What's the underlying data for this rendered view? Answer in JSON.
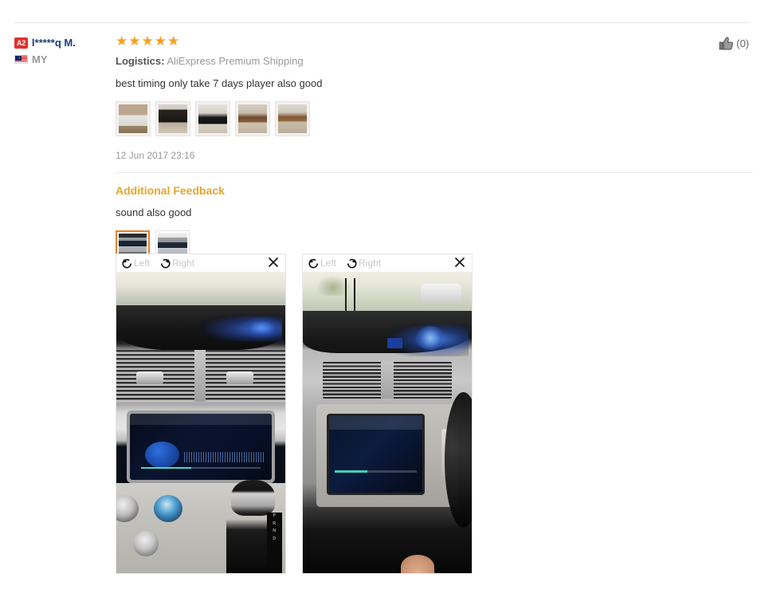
{
  "review": {
    "user": {
      "level_badge": "A2",
      "name": "l*****q M.",
      "country_code": "MY",
      "flag_icon": "malaysia-flag-icon"
    },
    "helpful": {
      "icon": "thumbs-up-icon",
      "count": "(0)"
    },
    "rating": {
      "stars_filled": 5,
      "stars_glyph": "★★★★★",
      "color": "#f7a021"
    },
    "logistics": {
      "label": "Logistics:",
      "value": "AliExpress Premium Shipping"
    },
    "text": "best timing only take 7 days player also good",
    "photos": [
      {
        "name": "review-photo-1"
      },
      {
        "name": "review-photo-2"
      },
      {
        "name": "review-photo-3"
      },
      {
        "name": "review-photo-4"
      },
      {
        "name": "review-photo-5"
      }
    ],
    "date": "12 Jun 2017 23:16"
  },
  "additional_feedback": {
    "title": "Additional Feedback",
    "title_color": "#e8a52a",
    "text": "sound also good",
    "thumbnails": [
      {
        "name": "additional-thumb-1",
        "selected": true
      },
      {
        "name": "additional-thumb-2",
        "selected": false
      }
    ]
  },
  "viewers": [
    {
      "rotate_left_label": "Left",
      "rotate_right_label": "Right",
      "close_label": "×",
      "rotate_left_icon": "rotate-left-icon",
      "rotate_right_icon": "rotate-right-icon",
      "close_icon": "close-icon",
      "image_name": "car-dashboard-headunit-closeup"
    },
    {
      "rotate_left_label": "Left",
      "rotate_right_label": "Right",
      "close_label": "×",
      "rotate_left_icon": "rotate-left-icon",
      "rotate_right_icon": "rotate-right-icon",
      "close_icon": "close-icon",
      "image_name": "car-dashboard-wide-view"
    }
  ]
}
